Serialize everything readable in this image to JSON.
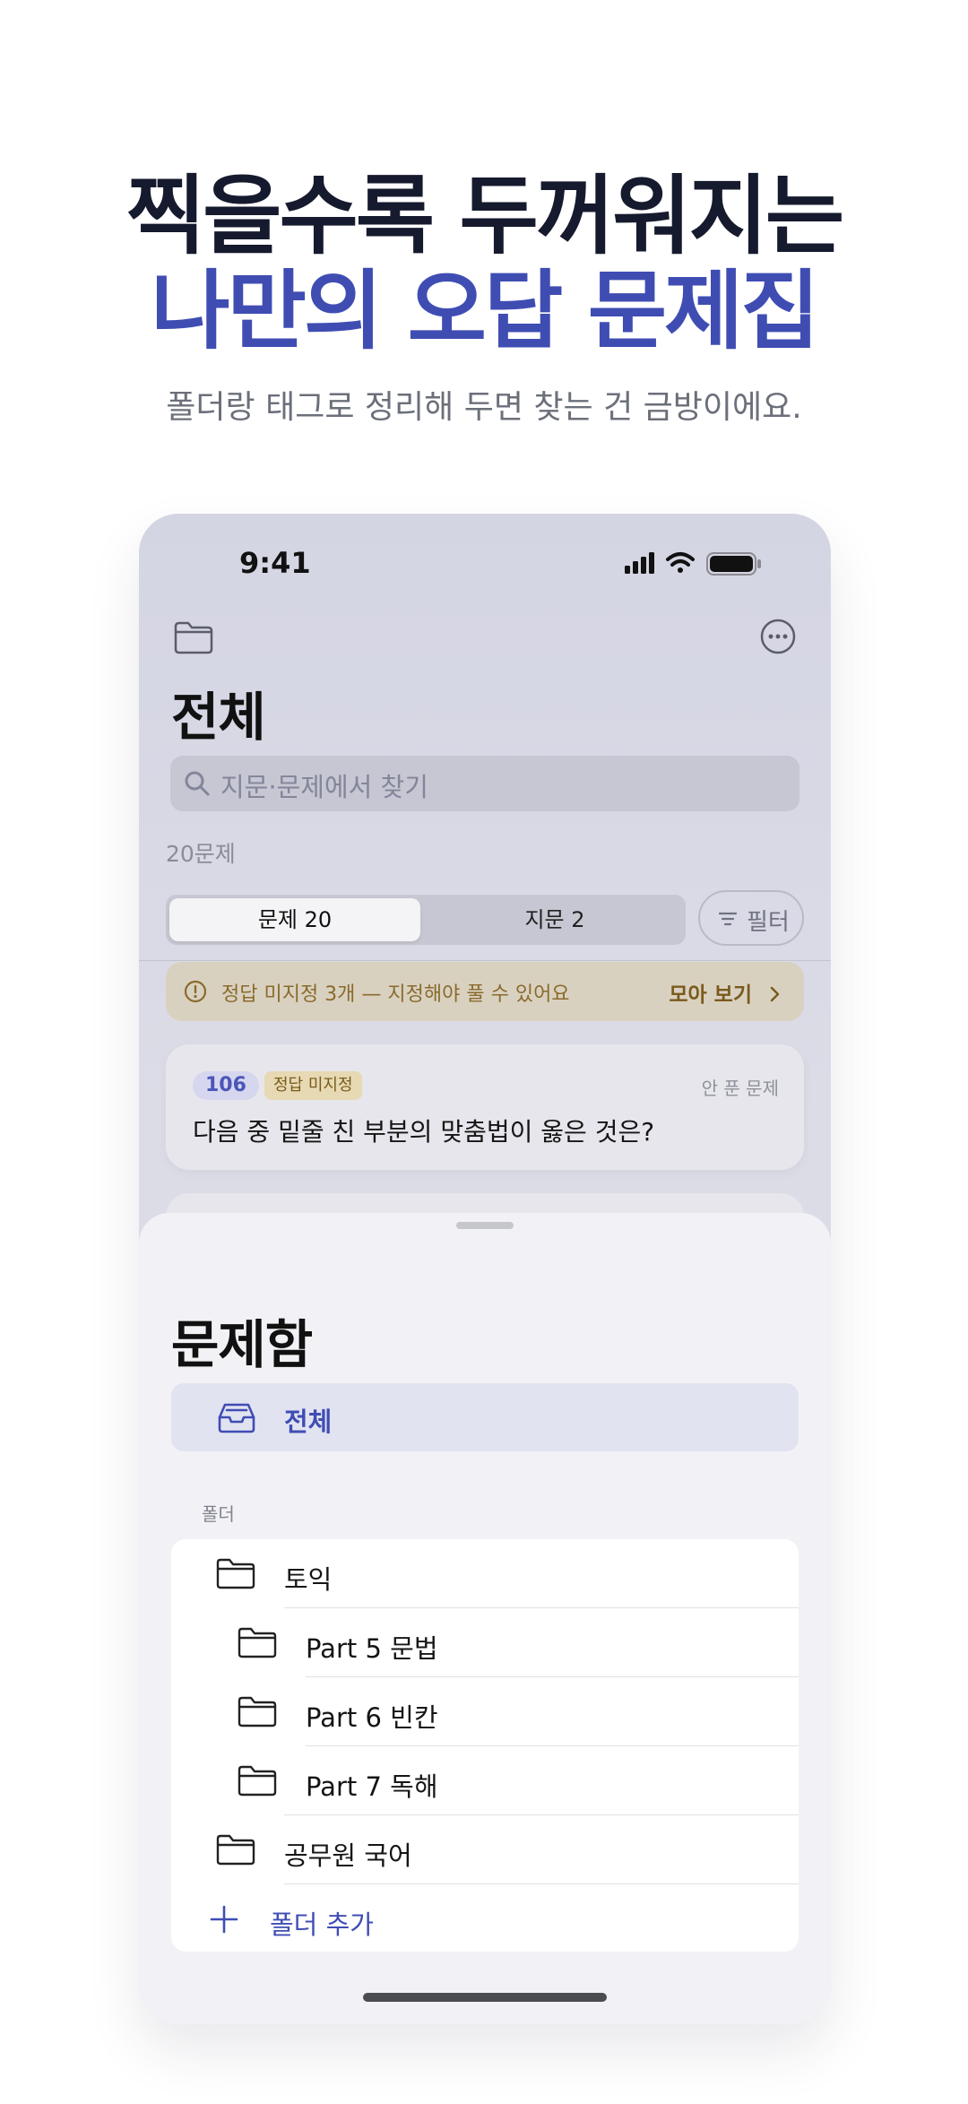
{
  "hero": {
    "line1": "찍을수록 두꺼워지는",
    "line2": "나만의 오답 문제집",
    "subtitle": "폴더랑 태그로 정리해 두면 찾는 건 금방이에요."
  },
  "status": {
    "time": "9:41"
  },
  "screen": {
    "title": "전체",
    "search_placeholder": "지문·문제에서 찾기",
    "count": "20문제",
    "segments": [
      {
        "label": "문제 20",
        "selected": true
      },
      {
        "label": "지문 2",
        "selected": false
      }
    ],
    "filter_label": "필터",
    "warning": {
      "text": "정답 미지정 3개 — 지정해야 풀 수 있어요",
      "action": "모아 보기"
    },
    "card": {
      "number": "106",
      "status": "정답 미지정",
      "meta": "안 푼 문제",
      "question": "다음 중 밑줄 친 부분의 맞춤법이 옳은 것은?"
    }
  },
  "sheet": {
    "title": "문제함",
    "all_label": "전체",
    "folder_header": "폴더",
    "folders": [
      {
        "label": "토익",
        "indent": 0
      },
      {
        "label": "Part 5 문법",
        "indent": 1
      },
      {
        "label": "Part 6 빈칸",
        "indent": 1
      },
      {
        "label": "Part 7 독해",
        "indent": 1
      },
      {
        "label": "공무원 국어",
        "indent": 0
      }
    ],
    "add_folder_label": "폴더 추가"
  },
  "colors": {
    "accent": "#3f4db3",
    "hero_dark": "#161a2e",
    "warning_text": "#8a6a2c",
    "warning_bg": "#d9d1c0"
  },
  "icons": [
    "folder-icon",
    "more-icon",
    "search-icon",
    "filter-icon",
    "alert-circle-icon",
    "chevron-right-icon",
    "inbox-icon",
    "plus-icon",
    "signal-icon",
    "wifi-icon",
    "battery-icon"
  ]
}
